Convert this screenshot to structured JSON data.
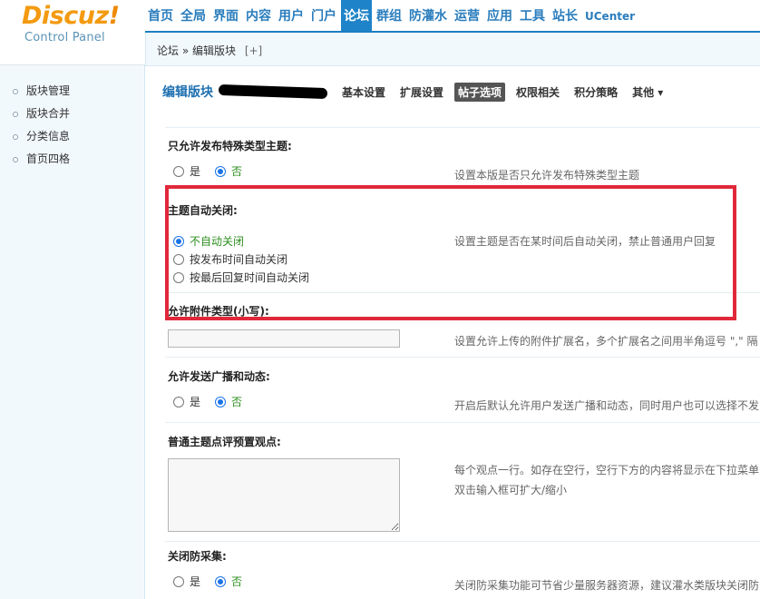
{
  "logo": {
    "brand": "Discuz",
    "bang": "!",
    "subtitle": "Control Panel"
  },
  "nav": {
    "items": [
      {
        "label": "首页",
        "active": false
      },
      {
        "label": "全局",
        "active": false
      },
      {
        "label": "界面",
        "active": false
      },
      {
        "label": "内容",
        "active": false
      },
      {
        "label": "用户",
        "active": false
      },
      {
        "label": "门户",
        "active": false
      },
      {
        "label": "论坛",
        "active": true
      },
      {
        "label": "群组",
        "active": false
      },
      {
        "label": "防灌水",
        "active": false
      },
      {
        "label": "运营",
        "active": false
      },
      {
        "label": "应用",
        "active": false
      },
      {
        "label": "工具",
        "active": false
      },
      {
        "label": "站长",
        "active": false
      },
      {
        "label": "UCenter",
        "active": false
      }
    ]
  },
  "breadcrumb": {
    "text": "论坛 » 编辑版块",
    "plus": "[+]"
  },
  "sidebar": {
    "items": [
      {
        "label": "版块管理"
      },
      {
        "label": "版块合并"
      },
      {
        "label": "分类信息"
      },
      {
        "label": "首页四格"
      }
    ]
  },
  "main": {
    "title": "编辑版块",
    "tabs": [
      {
        "label": "基本设置",
        "active": false
      },
      {
        "label": "扩展设置",
        "active": false
      },
      {
        "label": "帖子选项",
        "active": true
      },
      {
        "label": "权限相关",
        "active": false
      },
      {
        "label": "积分策略",
        "active": false
      },
      {
        "label": "其他 ▾",
        "active": false
      }
    ],
    "settings": {
      "special_only": {
        "label": "只允许发布特殊类型主题:",
        "yes": "是",
        "no": "否",
        "desc": "设置本版是否只允许发布特殊类型主题"
      },
      "auto_close": {
        "label": "主题自动关闭:",
        "opt1": "不自动关闭",
        "opt2": "按发布时间自动关闭",
        "opt3": "按最后回复时间自动关闭",
        "desc": "设置主题是否在某时间后自动关闭，禁止普通用户回复"
      },
      "attach_types": {
        "label": "允许附件类型(小写):",
        "value": "",
        "desc": "设置允许上传的附件扩展名，多个扩展名之间用半角逗号 \",\" 隔"
      },
      "broadcast": {
        "label": "允许发送广播和动态:",
        "yes": "是",
        "no": "否",
        "desc": "开启后默认允许用户发送广播和动态，同时用户也可以选择不发"
      },
      "viewpoints": {
        "label": "普通主题点评预置观点:",
        "value": "",
        "desc1": "每个观点一行。如存在空行，空行下方的内容将显示在下拉菜单",
        "desc2": "双击输入框可扩大/缩小"
      },
      "anti_collect": {
        "label": "关闭防采集:",
        "yes": "是",
        "no": "否",
        "desc": "关闭防采集功能可节省少量服务器资源，建议灌水类版块关闭防"
      }
    }
  },
  "colors": {
    "accent": "#1e83c8",
    "highlight": "#e0283a",
    "logo": "#f39a10"
  }
}
